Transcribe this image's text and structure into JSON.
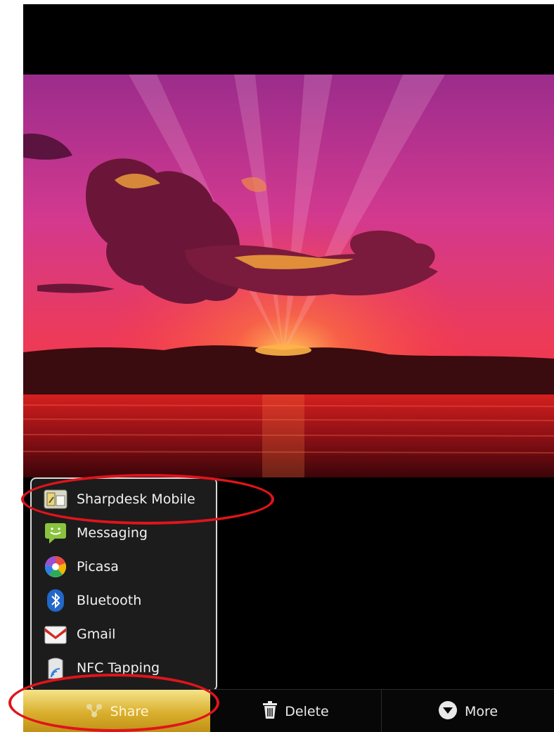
{
  "share_menu": {
    "items": [
      {
        "label": "Sharpdesk Mobile",
        "icon": "sharpdesk-mobile-icon"
      },
      {
        "label": "Messaging",
        "icon": "messaging-icon"
      },
      {
        "label": "Picasa",
        "icon": "picasa-icon"
      },
      {
        "label": "Bluetooth",
        "icon": "bluetooth-icon"
      },
      {
        "label": "Gmail",
        "icon": "gmail-icon"
      },
      {
        "label": "NFC Tapping",
        "icon": "nfc-tapping-icon"
      }
    ]
  },
  "action_bar": {
    "share": {
      "label": "Share",
      "icon": "share-icon"
    },
    "delete": {
      "label": "Delete",
      "icon": "trash-icon"
    },
    "more": {
      "label": "More",
      "icon": "more-icon"
    }
  },
  "annotations": {
    "color": "#e0141b"
  }
}
